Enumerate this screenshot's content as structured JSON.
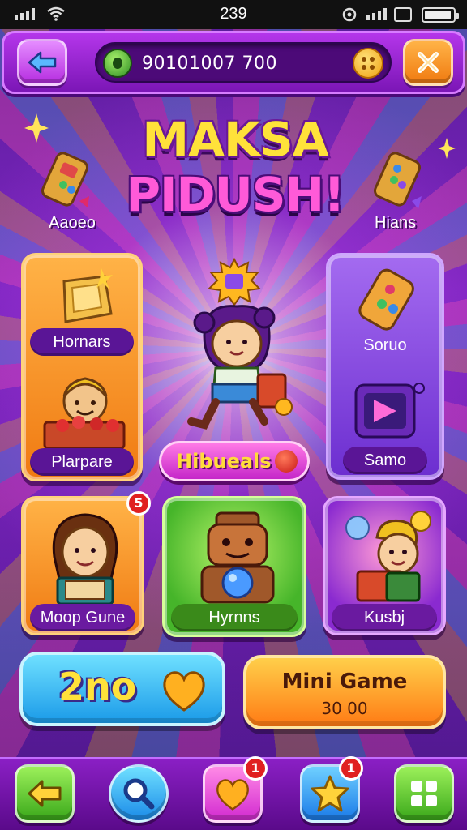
{
  "status_bar": {
    "time": "239"
  },
  "top_bar": {
    "currency_value": "90101007 700"
  },
  "title": {
    "line1": "MAKSA",
    "line2": "PIDUSH!"
  },
  "corner_labels": {
    "left": "Aaoeo",
    "right": "Hians"
  },
  "cards": {
    "left_top": "Hornars",
    "left_bottom": "Plarpare",
    "right_top": "Soruo",
    "right_bottom": "Samo",
    "row2_left": "Moop Gune",
    "row2_middle": "Hyrnns",
    "row2_right": "Kusbj"
  },
  "hero": {
    "label": "Hibueals"
  },
  "badges": {
    "row2_left": "5",
    "nav_heart": "1",
    "nav_star": "1"
  },
  "buttons": {
    "blue_label": "2no",
    "mini_game_title": "Mini Game",
    "mini_game_value": "30 00"
  },
  "icons": {
    "back": "back-arrow-icon",
    "close": "close-icon",
    "currency": "gem-icon",
    "coin": "coin-icon",
    "search": "search-icon",
    "heart": "heart-icon",
    "star": "star-icon",
    "grid": "grid-icon"
  },
  "colors": {
    "background": "#6a1aa0",
    "topbar": "#9a2ad0",
    "orange_card": "#f07a12",
    "purple_card": "#6c2ed0",
    "green_card": "#46b52a",
    "title_yellow": "#ffe23a",
    "title_pink": "#ff5ad8"
  }
}
